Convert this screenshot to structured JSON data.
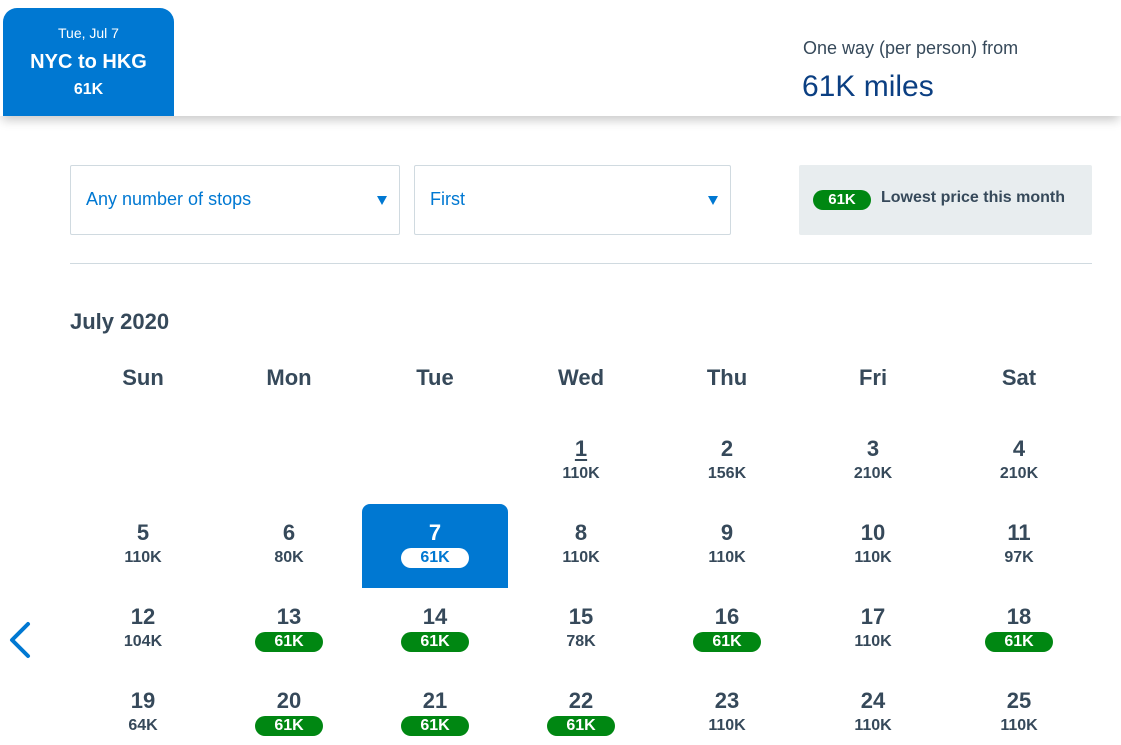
{
  "header": {
    "trip_date": "Tue, Jul 7",
    "trip_route": "NYC to HKG",
    "trip_price": "61K",
    "fare_label": "One way (per person) from",
    "fare_value": "61K miles"
  },
  "filters": {
    "stops": "Any number of stops",
    "cabin": "First"
  },
  "legend": {
    "pill": "61K",
    "text": "Lowest price this month"
  },
  "calendar": {
    "month": "July 2020",
    "weekdays": [
      "Sun",
      "Mon",
      "Tue",
      "Wed",
      "Thu",
      "Fri",
      "Sat"
    ],
    "days": [
      {
        "day": "1",
        "price": "110K",
        "today": true
      },
      {
        "day": "2",
        "price": "156K"
      },
      {
        "day": "3",
        "price": "210K"
      },
      {
        "day": "4",
        "price": "210K"
      },
      {
        "day": "5",
        "price": "110K"
      },
      {
        "day": "6",
        "price": "80K"
      },
      {
        "day": "7",
        "price": "61K",
        "lowest": true,
        "selected": true
      },
      {
        "day": "8",
        "price": "110K"
      },
      {
        "day": "9",
        "price": "110K"
      },
      {
        "day": "10",
        "price": "110K"
      },
      {
        "day": "11",
        "price": "97K"
      },
      {
        "day": "12",
        "price": "104K"
      },
      {
        "day": "13",
        "price": "61K",
        "lowest": true
      },
      {
        "day": "14",
        "price": "61K",
        "lowest": true
      },
      {
        "day": "15",
        "price": "78K"
      },
      {
        "day": "16",
        "price": "61K",
        "lowest": true
      },
      {
        "day": "17",
        "price": "110K"
      },
      {
        "day": "18",
        "price": "61K",
        "lowest": true
      },
      {
        "day": "19",
        "price": "64K"
      },
      {
        "day": "20",
        "price": "61K",
        "lowest": true
      },
      {
        "day": "21",
        "price": "61K",
        "lowest": true
      },
      {
        "day": "22",
        "price": "61K",
        "lowest": true
      },
      {
        "day": "23",
        "price": "110K"
      },
      {
        "day": "24",
        "price": "110K"
      },
      {
        "day": "25",
        "price": "110K"
      }
    ]
  },
  "icons": {
    "prev": "chevron-left-icon",
    "dropdown": "caret-down-icon"
  },
  "colors": {
    "brand_blue": "#0078d2",
    "lowest_green": "#008712",
    "text": "#36495a",
    "fare_navy": "#0b3f82"
  }
}
